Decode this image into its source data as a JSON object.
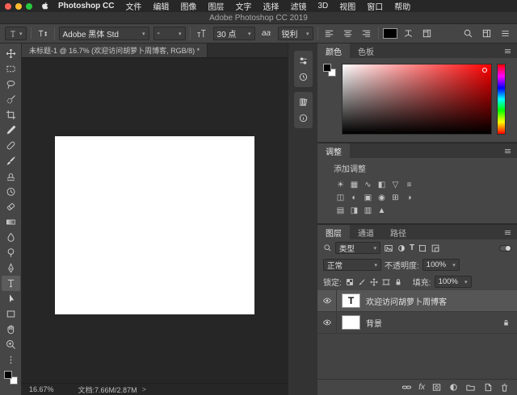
{
  "menubar": {
    "app_name": "Photoshop CC",
    "items": [
      "文件",
      "编辑",
      "图像",
      "图层",
      "文字",
      "选择",
      "滤镜",
      "3D",
      "视图",
      "窗口",
      "帮助"
    ]
  },
  "titlebar": {
    "title": "Adobe Photoshop CC 2019"
  },
  "options_bar": {
    "font_family": "Adobe 黑体 Std",
    "font_style": "-",
    "font_size": "30 点",
    "anti_alias_icon": "aa",
    "anti_alias": "锐利"
  },
  "document": {
    "tab_title": "未标题-1 @ 16.7% (欢迎访问胡萝卜周博客, RGB/8) *",
    "status_zoom": "16.67%",
    "status_doc": "文档:7.66M/2.87M",
    "status_chevron": ">"
  },
  "toolbar_tools": [
    "move",
    "rectangular-marquee",
    "lasso",
    "quick-selection",
    "crop",
    "eyedropper",
    "spot-healing-brush",
    "brush",
    "clone-stamp",
    "history-brush",
    "eraser",
    "gradient",
    "blur",
    "dodge",
    "pen",
    "type",
    "path-selection",
    "rectangle",
    "hand",
    "zoom"
  ],
  "active_tool": "type",
  "collapsed_panels": [
    "properties",
    "history",
    "libraries",
    "info"
  ],
  "color_panel": {
    "tabs": [
      "颜色",
      "色板"
    ],
    "active_tab": "颜色",
    "current_color": "#ff0000",
    "foreground": "#000000",
    "background": "#ffffff"
  },
  "adjustments_panel": {
    "tab": "调整",
    "add_label": "添加调整",
    "icons": [
      {
        "name": "brightness-contrast",
        "glyph": "☀"
      },
      {
        "name": "levels",
        "glyph": "▦"
      },
      {
        "name": "curves",
        "glyph": "∿"
      },
      {
        "name": "exposure",
        "glyph": "◧"
      },
      {
        "name": "vibrance",
        "glyph": "▽"
      },
      {
        "name": "hue-saturation",
        "glyph": "≡"
      },
      {
        "name": "color-balance",
        "glyph": "◫"
      },
      {
        "name": "black-white",
        "glyph": "◐"
      },
      {
        "name": "photo-filter",
        "glyph": "▣"
      },
      {
        "name": "channel-mixer",
        "glyph": "◉"
      },
      {
        "name": "color-lookup",
        "glyph": "⊞"
      },
      {
        "name": "invert",
        "glyph": "◑"
      },
      {
        "name": "posterize",
        "glyph": "▤"
      },
      {
        "name": "threshold",
        "glyph": "◨"
      },
      {
        "name": "gradient-map",
        "glyph": "▥"
      },
      {
        "name": "selective-color",
        "glyph": "▲"
      }
    ]
  },
  "layers_panel": {
    "tabs": [
      "图层",
      "通道",
      "路径"
    ],
    "active_tab": "图层",
    "filter_label": "类型",
    "blend_mode": "正常",
    "opacity_label": "不透明度:",
    "opacity_value": "100%",
    "lock_label": "锁定:",
    "fill_label": "填充:",
    "fill_value": "100%",
    "fx_label": "fx",
    "layers": [
      {
        "name": "欢迎访问胡萝卜周博客",
        "type": "text",
        "thumb_letter": "T",
        "selected": true,
        "visible": true
      },
      {
        "name": "背景",
        "type": "image",
        "selected": false,
        "visible": true,
        "locked": true
      }
    ]
  },
  "icons": {
    "caret_down": "▾",
    "apple": "apple-logo",
    "search": "magnifier",
    "panel_menu": "hamburger-lines"
  },
  "colors": {
    "panel_bg": "#464646",
    "canvas_area_bg": "#262626",
    "selected_row": "#565656",
    "accent_red": "#ff0000"
  }
}
